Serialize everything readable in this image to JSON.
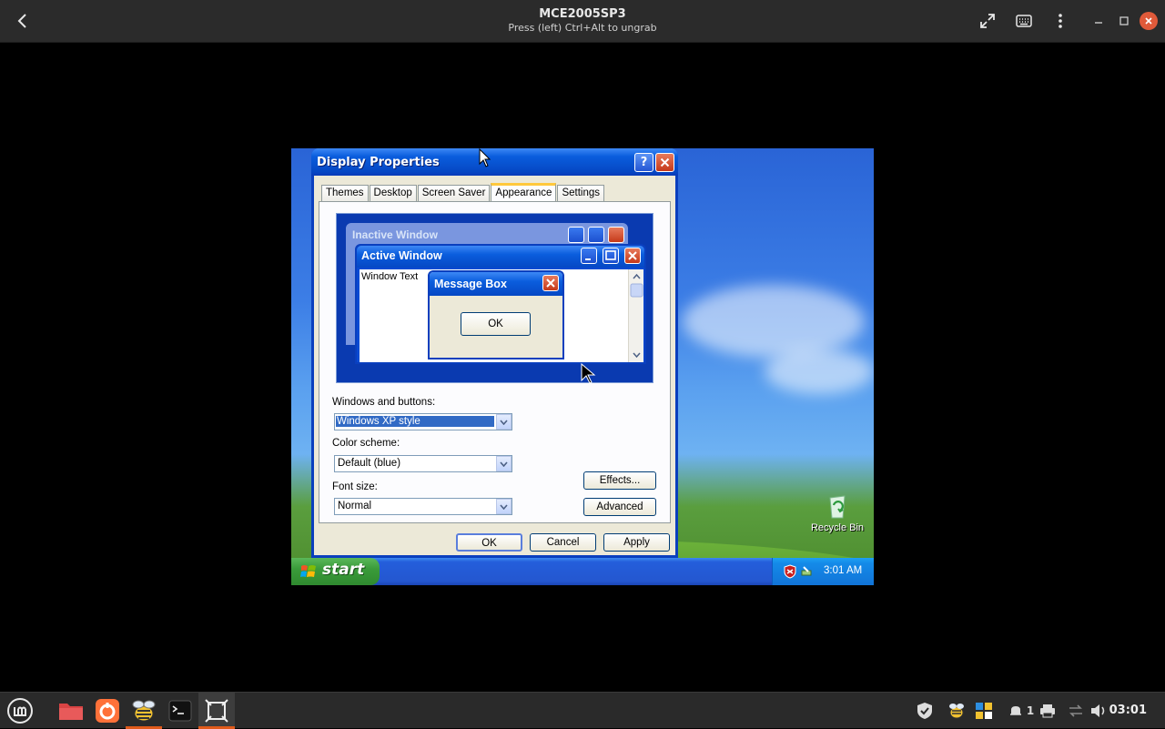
{
  "host": {
    "title": "MCE2005SP3",
    "subtitle": "Press (left) Ctrl+Alt to ungrab",
    "clock": "03:01",
    "notification_count": "1"
  },
  "dialog": {
    "title": "Display Properties",
    "tabs": [
      "Themes",
      "Desktop",
      "Screen Saver",
      "Appearance",
      "Settings"
    ],
    "active_tab": "Appearance",
    "preview": {
      "inactive_window": "Inactive Window",
      "active_window": "Active Window",
      "window_text": "Window Text",
      "message_box": "Message Box",
      "ok": "OK"
    },
    "windows_buttons_label": "Windows and buttons:",
    "windows_buttons_value": "Windows XP style",
    "color_scheme_label": "Color scheme:",
    "color_scheme_value": "Default (blue)",
    "font_size_label": "Font size:",
    "font_size_value": "Normal",
    "effects_button": "Effects...",
    "advanced_button": "Advanced",
    "ok_button": "OK",
    "cancel_button": "Cancel",
    "apply_button": "Apply"
  },
  "guest": {
    "start_label": "start",
    "tray_time": "3:01 AM",
    "recycle_bin": "Recycle Bin"
  }
}
